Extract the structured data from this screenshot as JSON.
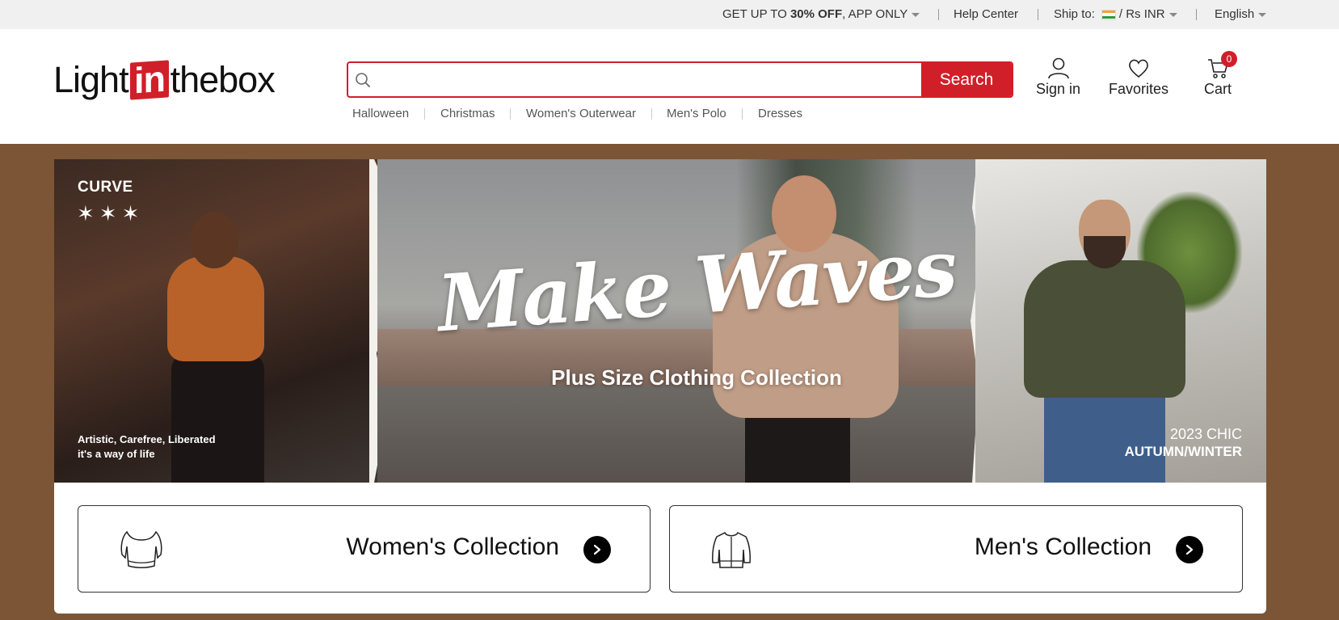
{
  "topbar": {
    "promo_prefix": "GET UP TO ",
    "promo_bold": "30% OFF",
    "promo_suffix": ", APP ONLY",
    "help_center": "Help Center",
    "ship_to_label": "Ship to:",
    "currency": "Rs INR",
    "language": "English"
  },
  "header": {
    "logo_light": "Light",
    "logo_in": "in",
    "logo_thebox": "thebox",
    "search": {
      "placeholder": "",
      "value": "",
      "button": "Search"
    },
    "hot_keywords": [
      "Halloween",
      "Christmas",
      "Women's Outerwear",
      "Men's Polo",
      "Dresses"
    ],
    "actions": {
      "sign_in": "Sign in",
      "favorites": "Favorites",
      "cart": "Cart",
      "cart_count": "0"
    }
  },
  "banner": {
    "left_title": "CURVE",
    "left_stars": "✶✶✶",
    "tagline_line1": "Artistic, Carefree, Liberated",
    "tagline_line2": "it's a way of life",
    "headline": "Make Waves",
    "subhead": "Plus Size Clothing Collection",
    "season_line1": "2023 CHIC",
    "season_line2": "AUTUMN/WINTER"
  },
  "collections": [
    {
      "label": "Women's Collection",
      "icon": "womens-top-icon"
    },
    {
      "label": "Men's Collection",
      "icon": "jacket-icon"
    }
  ],
  "colors": {
    "brand_red": "#d11f2a",
    "page_brown": "#7b5535",
    "topbar_bg": "#f0f0f0"
  }
}
